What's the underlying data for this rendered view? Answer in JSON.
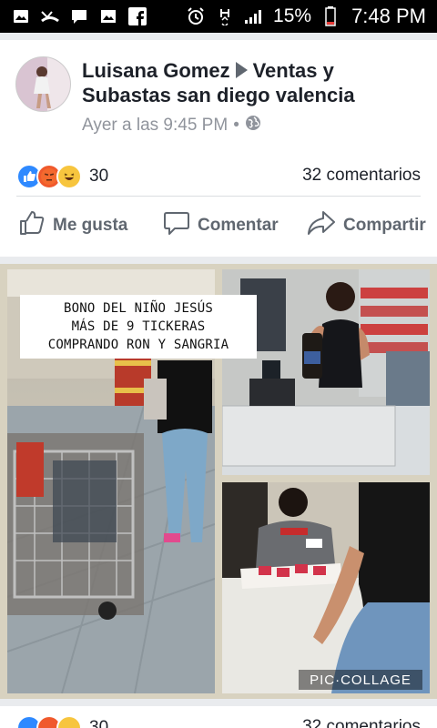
{
  "status_bar": {
    "battery": "15%",
    "time": "7:48 PM",
    "icons_left": [
      "image-icon",
      "missed-call-icon",
      "chat-icon",
      "gallery-icon",
      "facebook-icon"
    ],
    "icons_right": [
      "alarm-icon",
      "hspa-icon",
      "signal-icon",
      "battery-icon"
    ]
  },
  "post": {
    "author": "Luisana Gomez",
    "group": "Ventas y Subastas san diego valencia",
    "timestamp": "Ayer a las 9:45 PM",
    "privacy_icon": "globe-icon",
    "reaction_count": "30",
    "reaction_icons": [
      "like-icon",
      "angry-icon",
      "haha-icon"
    ],
    "comments_count": "32 comentarios",
    "actions": {
      "like": "Me gusta",
      "comment": "Comentar",
      "share": "Compartir"
    },
    "photo_caption": [
      "BONO DEL NIÑO JESÚS",
      "MÁS DE 9 TICKERAS",
      "COMPRANDO RON Y SANGRIA"
    ],
    "watermark": "PIC·COLLAGE"
  },
  "next_post": {
    "reaction_count": "30",
    "comments_count": "32 comentarios"
  }
}
